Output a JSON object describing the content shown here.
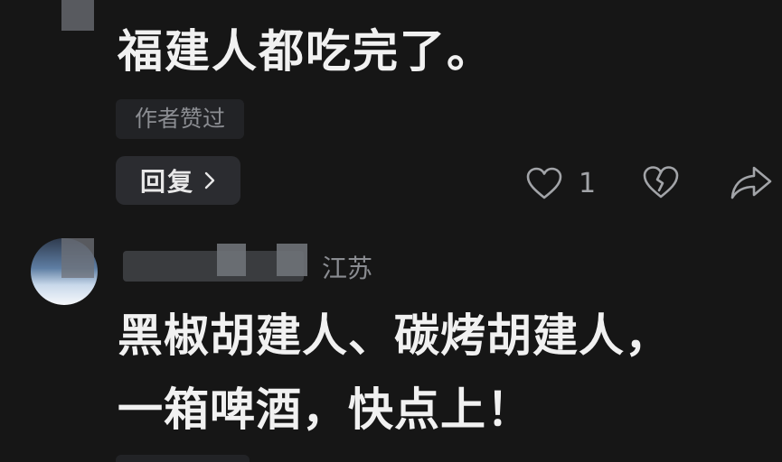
{
  "comments": [
    {
      "text": "福建人都吃完了。",
      "badge": "作者赞过",
      "reply_label": "回复",
      "like_count": "1",
      "icons": [
        "heart-icon",
        "broken-heart-icon",
        "share-icon",
        "chevron-right-icon"
      ]
    },
    {
      "location": "江苏",
      "text_lines": [
        "黑椒胡建人、碳烤胡建人，",
        "一箱啤酒，快点上！"
      ]
    }
  ],
  "colors": {
    "background": "#161616",
    "text_primary": "#f1f1f1",
    "text_secondary": "#8a8c91",
    "button_bg": "#2b2c30",
    "badge_bg": "#222326"
  }
}
